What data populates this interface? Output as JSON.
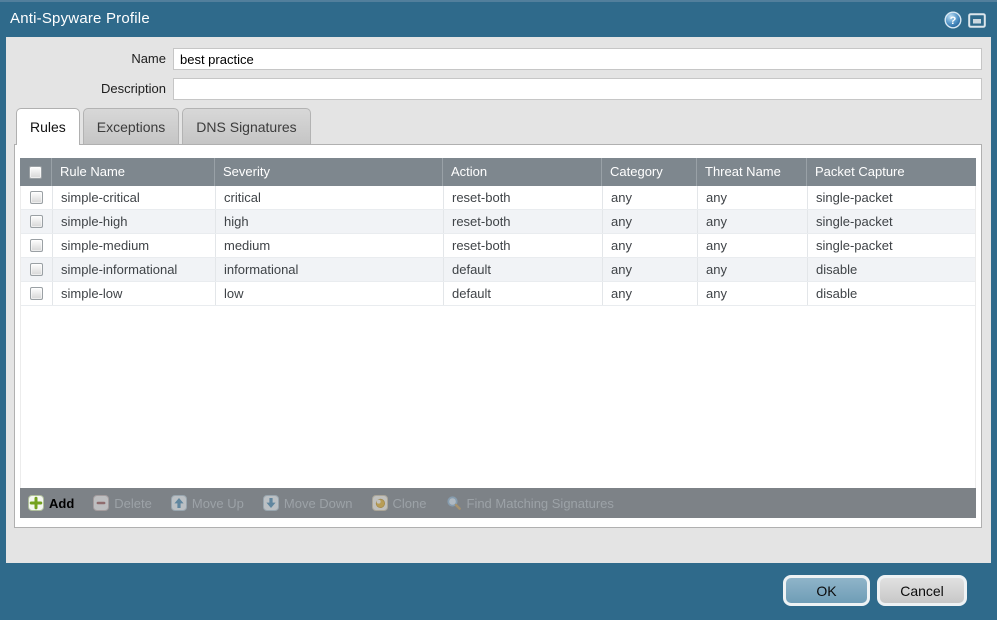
{
  "window": {
    "title": "Anti-Spyware Profile",
    "help_glyph": "?"
  },
  "form": {
    "name_label": "Name",
    "name_value": "best practice",
    "description_label": "Description",
    "description_value": ""
  },
  "tabs": [
    {
      "label": "Rules"
    },
    {
      "label": "Exceptions"
    },
    {
      "label": "DNS Signatures"
    }
  ],
  "table": {
    "columns": [
      "Rule Name",
      "Severity",
      "Action",
      "Category",
      "Threat Name",
      "Packet Capture"
    ],
    "rows": [
      {
        "rule_name": "simple-critical",
        "severity": "critical",
        "action": "reset-both",
        "category": "any",
        "threat_name": "any",
        "packet_capture": "single-packet"
      },
      {
        "rule_name": "simple-high",
        "severity": "high",
        "action": "reset-both",
        "category": "any",
        "threat_name": "any",
        "packet_capture": "single-packet"
      },
      {
        "rule_name": "simple-medium",
        "severity": "medium",
        "action": "reset-both",
        "category": "any",
        "threat_name": "any",
        "packet_capture": "single-packet"
      },
      {
        "rule_name": "simple-informational",
        "severity": "informational",
        "action": "default",
        "category": "any",
        "threat_name": "any",
        "packet_capture": "disable"
      },
      {
        "rule_name": "simple-low",
        "severity": "low",
        "action": "default",
        "category": "any",
        "threat_name": "any",
        "packet_capture": "disable"
      }
    ]
  },
  "toolbar": {
    "add": "Add",
    "delete": "Delete",
    "move_up": "Move Up",
    "move_down": "Move Down",
    "clone": "Clone",
    "find": "Find Matching Signatures"
  },
  "footer": {
    "ok": "OK",
    "cancel": "Cancel"
  },
  "colors": {
    "titlebar": "#2F6A8B",
    "table_header": "#7E878E",
    "toolbar": "#7D8287",
    "ok_button": "#7CA7BE",
    "add_green": "#74A21F"
  }
}
